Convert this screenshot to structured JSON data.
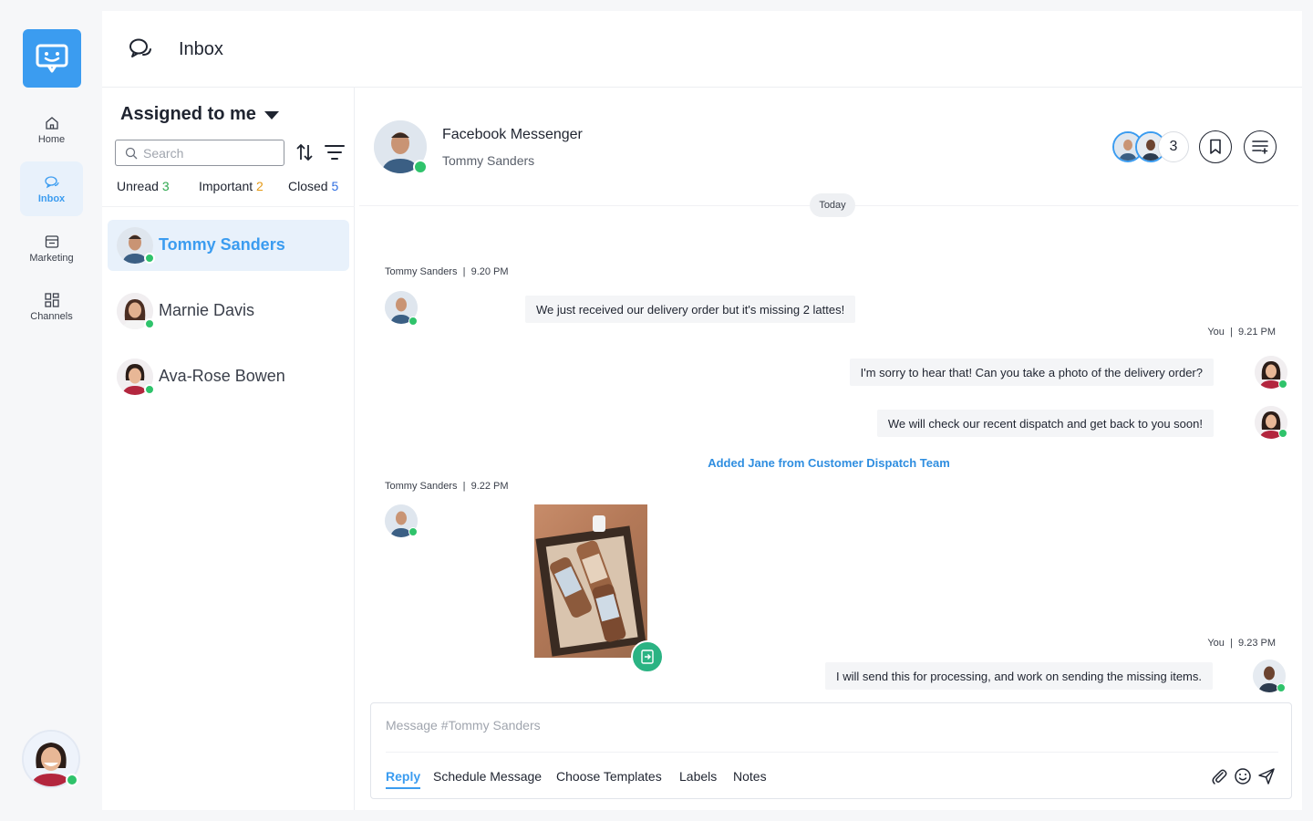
{
  "header": {
    "title": "Inbox"
  },
  "nav": {
    "items": [
      {
        "label": "Home"
      },
      {
        "label": "Inbox"
      },
      {
        "label": "Marketing"
      },
      {
        "label": "Channels"
      }
    ]
  },
  "list": {
    "assignment": "Assigned to me",
    "search_placeholder": "Search",
    "tabs": [
      {
        "label": "Unread",
        "count": "3"
      },
      {
        "label": "Important",
        "count": "2"
      },
      {
        "label": "Closed",
        "count": "5"
      }
    ],
    "conversations": [
      {
        "name": "Tommy Sanders"
      },
      {
        "name": "Marnie Davis"
      },
      {
        "name": "Ava-Rose Bowen"
      }
    ]
  },
  "chat": {
    "channel": "Facebook Messenger",
    "contact": "Tommy Sanders",
    "participants_count": "3",
    "day_label": "Today",
    "messages": [
      {
        "sender": "Tommy Sanders",
        "time": "9.20 PM",
        "text": "We just received our delivery order but it's missing 2 lattes!"
      },
      {
        "sender": "You",
        "time": "9.21 PM",
        "text": "I'm sorry to hear that! Can you take a photo of the delivery order?"
      },
      {
        "text": "We will check our recent dispatch and get back to you soon!"
      },
      {
        "system": "Added Jane from Customer Dispatch Team"
      },
      {
        "sender": "Tommy Sanders",
        "time": "9.22 PM"
      },
      {
        "sender": "You",
        "time": "9.23 PM",
        "text": "I will send this for processing, and work on sending the missing items."
      }
    ],
    "meta_separator": "|"
  },
  "composer": {
    "placeholder": "Message #Tommy Sanders",
    "tabs": [
      "Reply",
      "Schedule Message",
      "Choose Templates",
      "Labels",
      "Notes"
    ]
  },
  "colors": {
    "accent": "#3b9cf0",
    "online": "#2fc36b",
    "system": "#2f8ee0"
  },
  "icons": [
    "chat-bubbles-icon",
    "home-icon",
    "store-icon",
    "grid-icon",
    "search-icon",
    "sort-icon",
    "filter-icon",
    "bookmark-icon",
    "menu-icon",
    "attach-icon",
    "emoji-icon",
    "send-icon",
    "export-icon"
  ]
}
